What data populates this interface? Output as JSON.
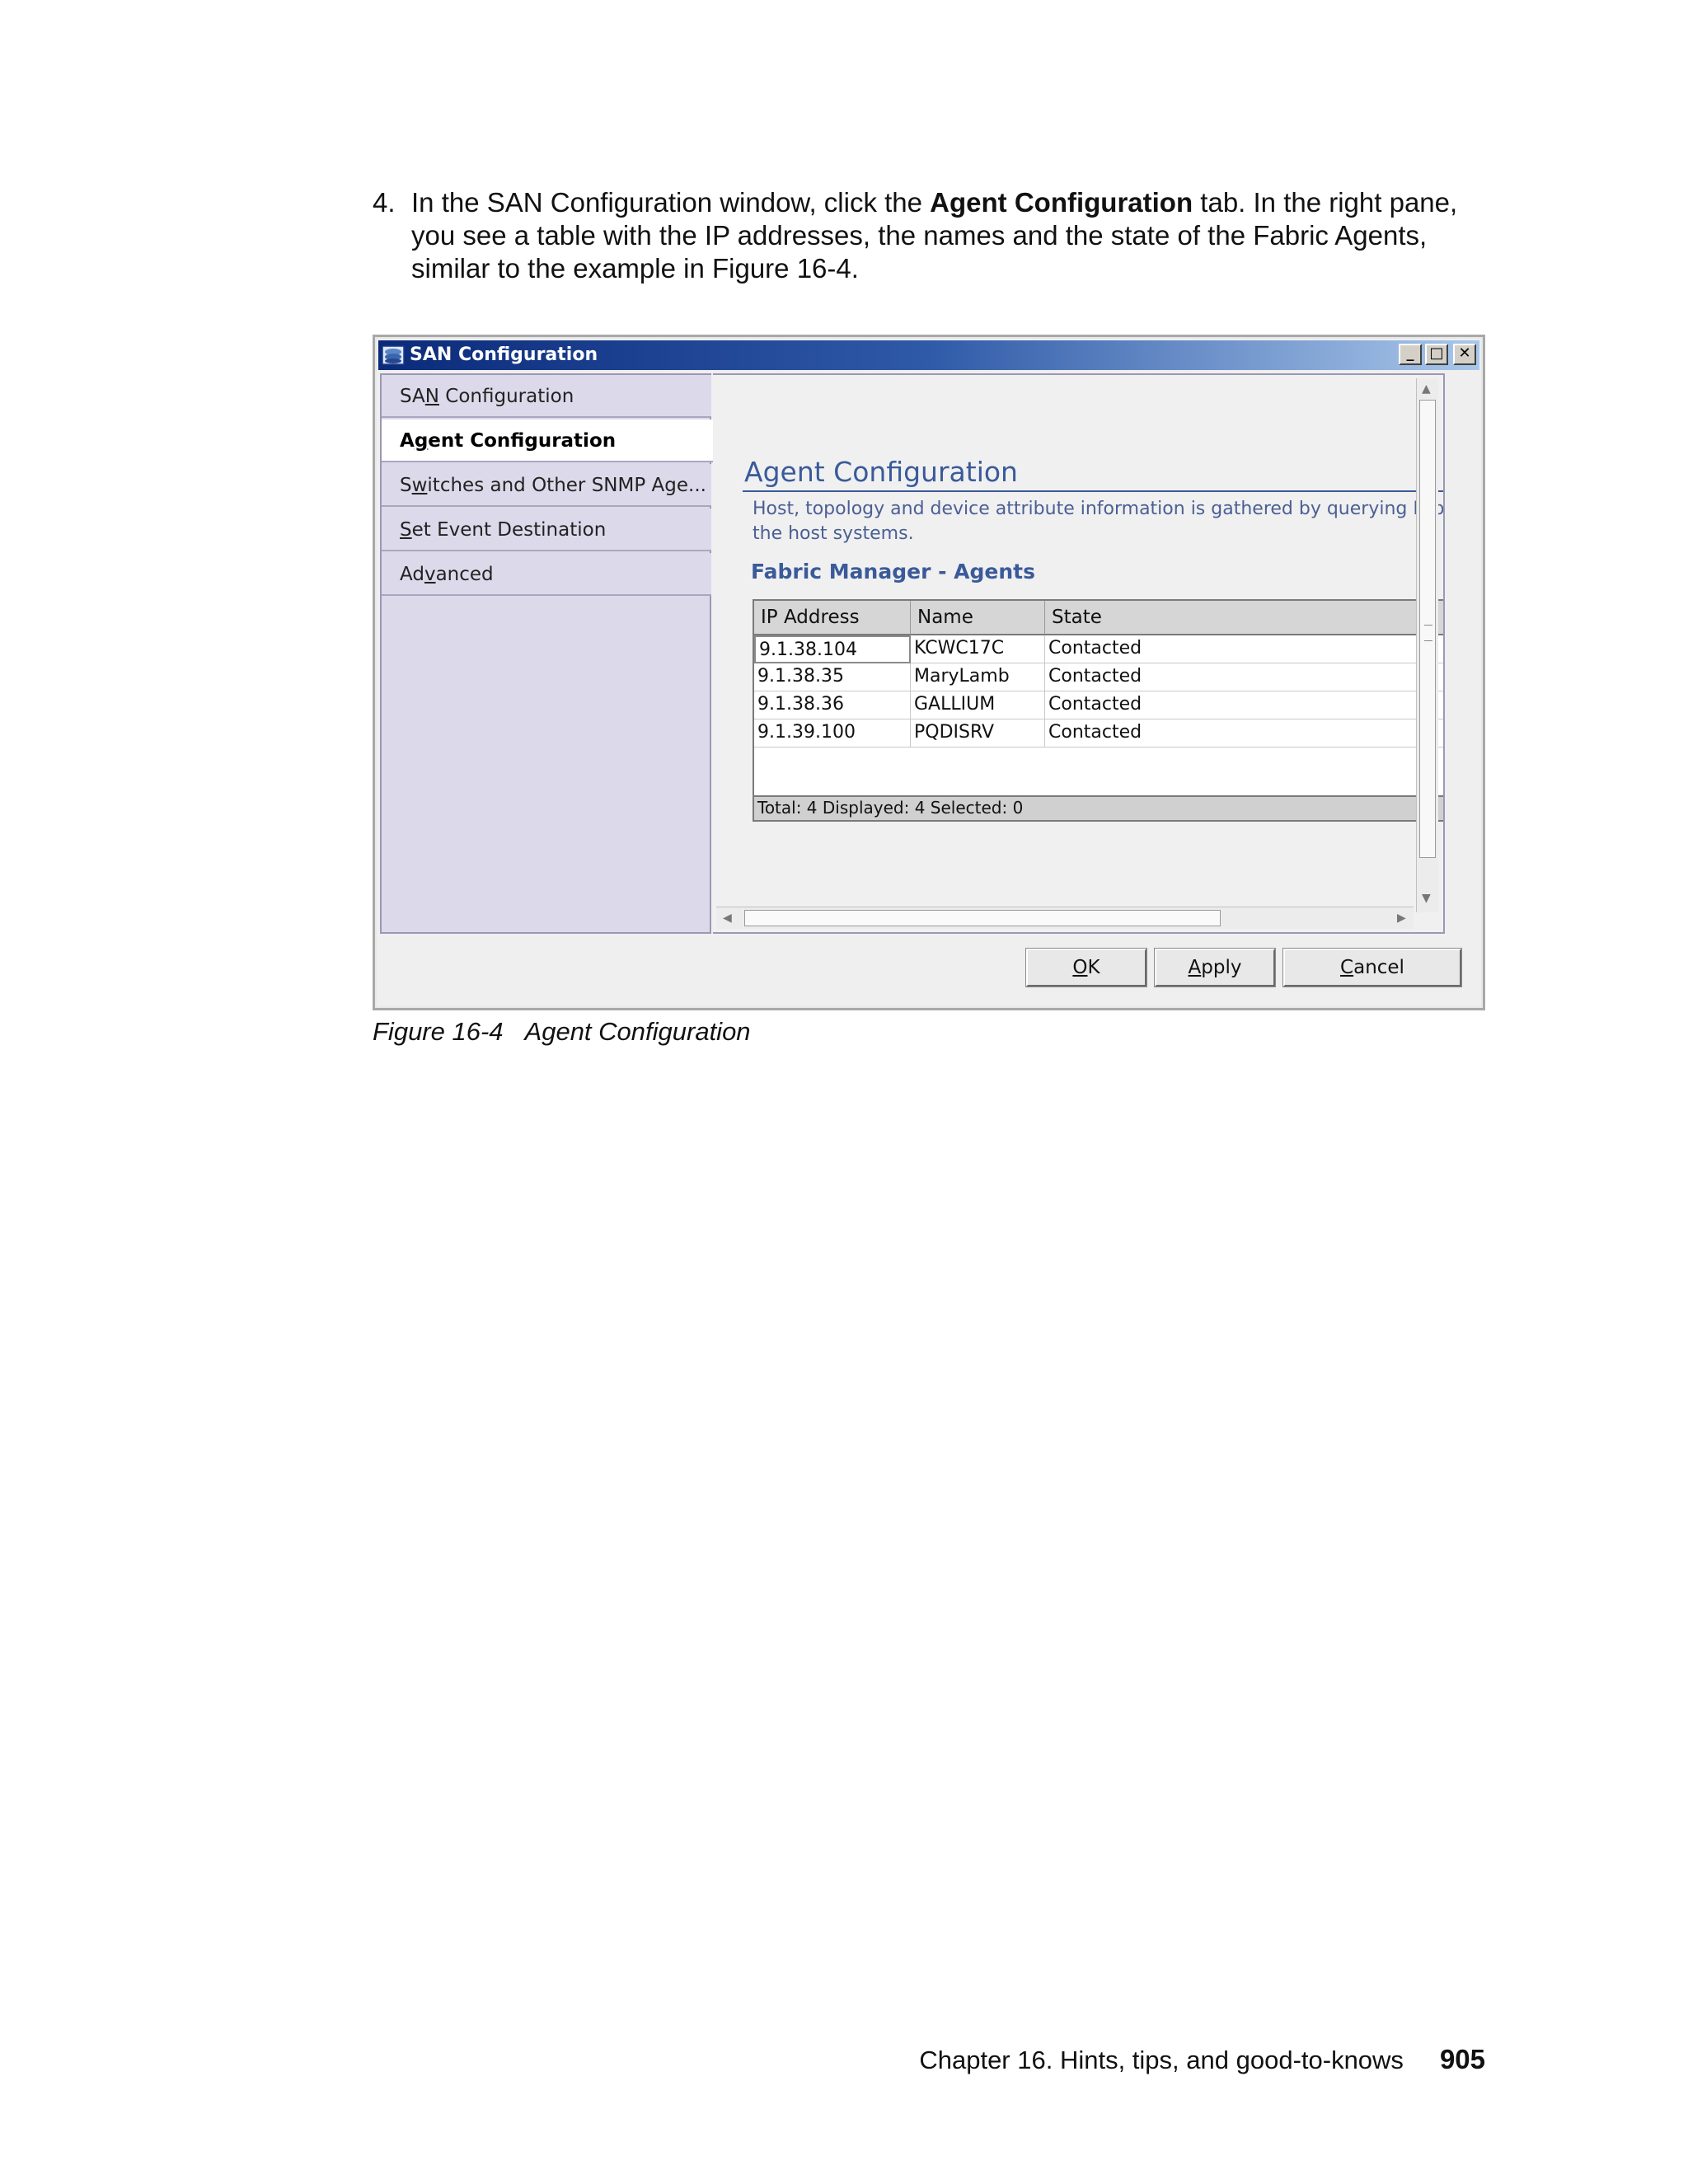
{
  "instructions": {
    "step_number": "4.",
    "text_before": "In the SAN Configuration window, click the ",
    "text_bold": "Agent Configuration",
    "text_after": " tab. In the right pane, you see a table with the IP addresses, the names and the state of the Fabric Agents, similar to the example in Figure 16-4."
  },
  "window": {
    "title": "SAN Configuration",
    "min_glyph": "_",
    "max_glyph": "□",
    "close_glyph": "✕"
  },
  "nav": {
    "items": [
      {
        "pre": "SA",
        "u": "N",
        "post": " Configuration"
      },
      {
        "pre": "A",
        "u": "g",
        "post": "ent Configuration"
      },
      {
        "pre": "S",
        "u": "w",
        "post": "itches and Other SNMP Age..."
      },
      {
        "pre": "",
        "u": "S",
        "post": "et Event Destination"
      },
      {
        "pre": "Ad",
        "u": "v",
        "post": "anced"
      }
    ]
  },
  "content": {
    "heading": "Agent Configuration",
    "desc_line1": "Host, topology and device attribute information is gathered by querying Fabric M",
    "desc_line2": "the host systems.",
    "section_title": "Fabric Manager - Agents"
  },
  "table": {
    "columns": [
      "IP Address",
      "Name",
      "State"
    ],
    "rows": [
      [
        "9.1.38.104",
        "KCWC17C",
        "Contacted"
      ],
      [
        "9.1.38.35",
        "MaryLamb",
        "Contacted"
      ],
      [
        "9.1.38.36",
        "GALLIUM",
        "Contacted"
      ],
      [
        "9.1.39.100",
        "PQDISRV",
        "Contacted"
      ]
    ],
    "status": "Total: 4 Displayed: 4 Selected: 0"
  },
  "buttons": {
    "ok": {
      "u": "O",
      "post": "K"
    },
    "apply": {
      "u": "A",
      "post": "pply"
    },
    "cancel": {
      "u": "C",
      "post": "ancel"
    }
  },
  "caption": {
    "label": "Figure 16-4",
    "title": "Agent Configuration"
  },
  "footer": {
    "chapter": "Chapter 16. Hints, tips, and good-to-knows",
    "page": "905"
  }
}
